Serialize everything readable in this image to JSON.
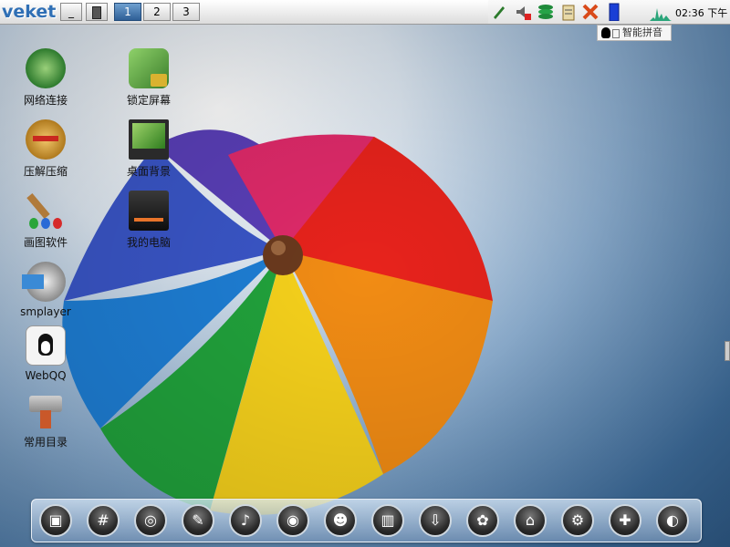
{
  "topbar": {
    "logo": "veket",
    "minimize_label": "_",
    "desktops": [
      "1",
      "2",
      "3"
    ],
    "active_desktop": "1",
    "clock": "02:36 下午",
    "ime_label": "智能拼音"
  },
  "tray_icons": [
    "pen-icon",
    "volume-muted-icon",
    "network-icon",
    "clipboard-icon",
    "close-x-icon",
    "battery-icon",
    "cpu-graph-icon"
  ],
  "desktop_icons": [
    {
      "name": "network-connect",
      "label": "网络连接",
      "icon": "globe-icon"
    },
    {
      "name": "lock-screen",
      "label": "锁定屏幕",
      "icon": "lock-icon"
    },
    {
      "name": "archive",
      "label": "压解压缩",
      "icon": "archive-icon"
    },
    {
      "name": "wallpaper",
      "label": "桌面背景",
      "icon": "monitor-icon"
    },
    {
      "name": "paint",
      "label": "画图软件",
      "icon": "paintbrush-icon"
    },
    {
      "name": "my-computer",
      "label": "我的电脑",
      "icon": "drive-icon"
    },
    {
      "name": "smplayer",
      "label": "smplayer",
      "icon": "film-icon"
    },
    {
      "name": "webqq",
      "label": "WebQQ",
      "icon": "penguin-icon"
    },
    {
      "name": "common-dirs",
      "label": "常用目录",
      "icon": "toolbox-icon"
    }
  ],
  "dock_items": [
    "folder-icon",
    "terminal-icon",
    "firefox-icon",
    "edit-icon",
    "music-icon",
    "media-icon",
    "chat-icon",
    "equalizer-icon",
    "installer-icon",
    "graphics-icon",
    "mouse-icon",
    "settings-icon",
    "help-icon",
    "color-icon"
  ],
  "dock_glyphs": [
    "▣",
    "#",
    "◎",
    "✎",
    "♪",
    "◉",
    "☻",
    "▥",
    "⇩",
    "✿",
    "⌂",
    "⚙",
    "✚",
    "◐"
  ]
}
